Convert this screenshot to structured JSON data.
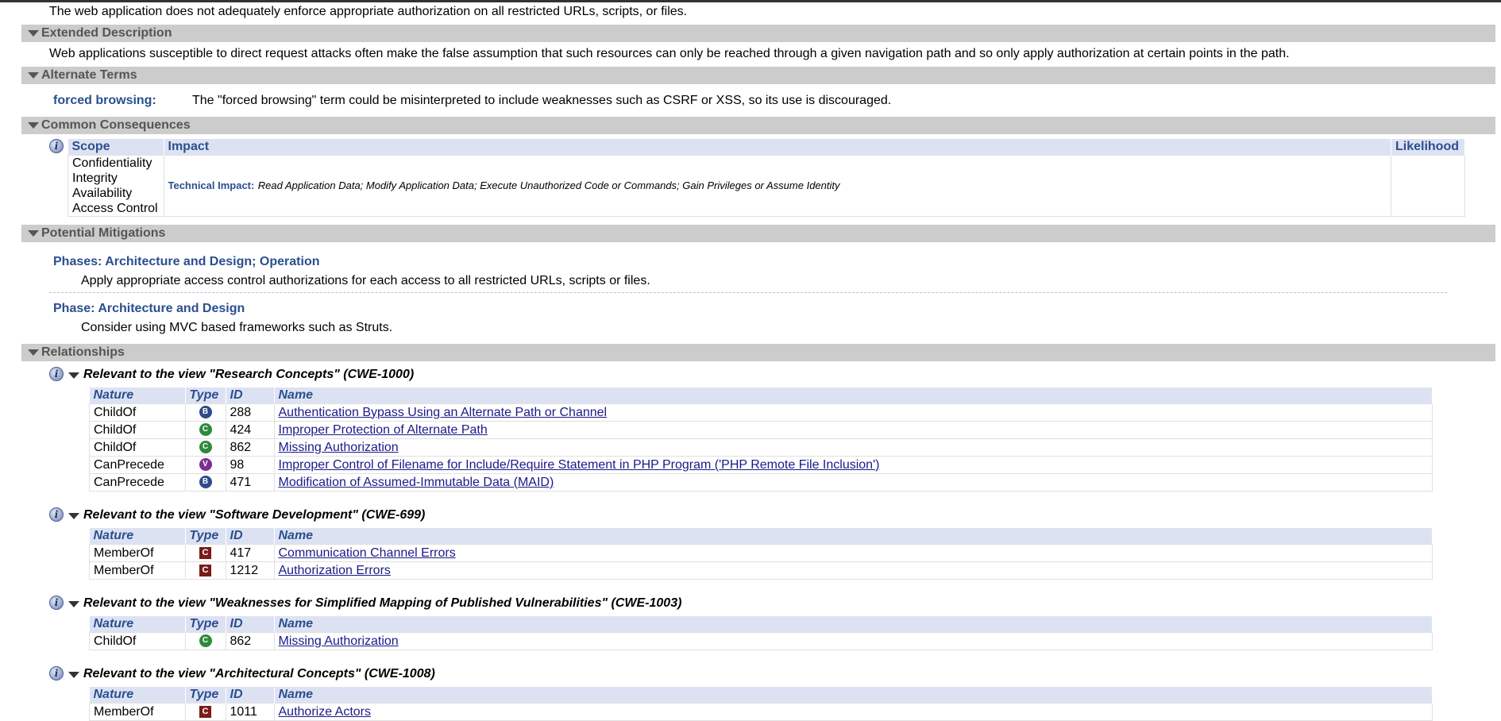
{
  "intro_text": "The web application does not adequately enforce appropriate authorization on all restricted URLs, scripts, or files.",
  "sections": {
    "extended_description": {
      "title": "Extended Description",
      "text": "Web applications susceptible to direct request attacks often make the false assumption that such resources can only be reached through a given navigation path and so only apply authorization at certain points in the path."
    },
    "alternate_terms": {
      "title": "Alternate Terms",
      "term": "forced browsing:",
      "description": "The \"forced browsing\" term could be misinterpreted to include weaknesses such as CSRF or XSS, so its use is discouraged."
    },
    "common_consequences": {
      "title": "Common Consequences",
      "headers": {
        "scope": "Scope",
        "impact": "Impact",
        "likelihood": "Likelihood"
      },
      "scopes": [
        "Confidentiality",
        "Integrity",
        "Availability",
        "Access Control"
      ],
      "impact_label": "Technical Impact:",
      "impact_text": "Read Application Data; Modify Application Data; Execute Unauthorized Code or Commands; Gain Privileges or Assume Identity"
    },
    "potential_mitigations": {
      "title": "Potential Mitigations",
      "items": [
        {
          "phase": "Phases: Architecture and Design; Operation",
          "text": "Apply appropriate access control authorizations for each access to all restricted URLs, scripts or files."
        },
        {
          "phase": "Phase: Architecture and Design",
          "text": "Consider using MVC based frameworks such as Struts."
        }
      ]
    },
    "relationships": {
      "title": "Relationships",
      "table_headers": {
        "nature": "Nature",
        "type": "Type",
        "id": "ID",
        "name": "Name"
      },
      "views": [
        {
          "title": "Relevant to the view \"Research Concepts\" (CWE-1000)",
          "rows": [
            {
              "nature": "ChildOf",
              "type": "B",
              "id": "288",
              "name": "Authentication Bypass Using an Alternate Path or Channel"
            },
            {
              "nature": "ChildOf",
              "type": "C",
              "id": "424",
              "name": "Improper Protection of Alternate Path"
            },
            {
              "nature": "ChildOf",
              "type": "C",
              "id": "862",
              "name": "Missing Authorization"
            },
            {
              "nature": "CanPrecede",
              "type": "V",
              "id": "98",
              "name": "Improper Control of Filename for Include/Require Statement in PHP Program ('PHP Remote File Inclusion')"
            },
            {
              "nature": "CanPrecede",
              "type": "B",
              "id": "471",
              "name": "Modification of Assumed-Immutable Data (MAID)"
            }
          ]
        },
        {
          "title": "Relevant to the view \"Software Development\" (CWE-699)",
          "rows": [
            {
              "nature": "MemberOf",
              "type": "C",
              "id": "417",
              "name": "Communication Channel Errors"
            },
            {
              "nature": "MemberOf",
              "type": "C",
              "id": "1212",
              "name": "Authorization Errors"
            }
          ]
        },
        {
          "title": "Relevant to the view \"Weaknesses for Simplified Mapping of Published Vulnerabilities\" (CWE-1003)",
          "rows": [
            {
              "nature": "ChildOf",
              "type": "C",
              "id": "862",
              "name": "Missing Authorization"
            }
          ]
        },
        {
          "title": "Relevant to the view \"Architectural Concepts\" (CWE-1008)",
          "rows": [
            {
              "nature": "MemberOf",
              "type": "C",
              "id": "1011",
              "name": "Authorize Actors"
            }
          ]
        }
      ]
    }
  },
  "colors": {
    "section_header_bg": "#cccccc",
    "section_header_text": "#555555",
    "accent_blue": "#2a4f8f",
    "table_header_bg": "#dde2f3",
    "category_icon": "#7a1a1a",
    "base_icon": "#2f4b8a",
    "class_icon": "#2e8b3a",
    "variant_icon": "#7b2f8f"
  },
  "icons": {
    "section_toggle": "triangle-down-icon",
    "view_info": "info-icon",
    "type_base": "base-weakness-icon",
    "type_class": "class-weakness-icon",
    "type_variant": "variant-weakness-icon",
    "type_category": "category-icon"
  }
}
